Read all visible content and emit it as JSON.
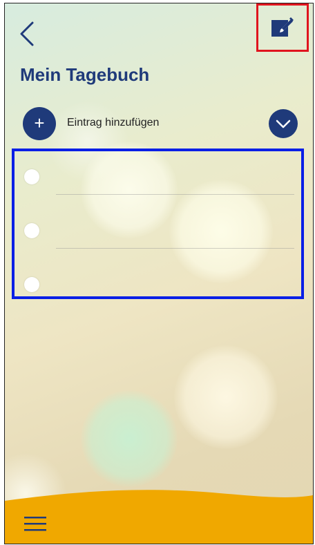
{
  "header": {
    "back_icon": "chevron-left-icon",
    "edit_icon": "edit-note-icon",
    "title": "Mein Tagebuch"
  },
  "add_entry": {
    "label": "Eintrag hinzufügen",
    "add_icon": "plus",
    "add_symbol": "+",
    "expand_icon": "chevron-down-icon"
  },
  "entries": [
    {
      "text": "",
      "checked": false
    },
    {
      "text": "",
      "checked": false
    },
    {
      "text": "",
      "checked": false
    }
  ],
  "footer": {
    "menu_icon": "hamburger-menu-icon"
  },
  "colors": {
    "primary": "#1f3a7a",
    "footer": "#f0a800",
    "highlight_red": "#e0141e",
    "highlight_blue": "#0a1fe6"
  }
}
